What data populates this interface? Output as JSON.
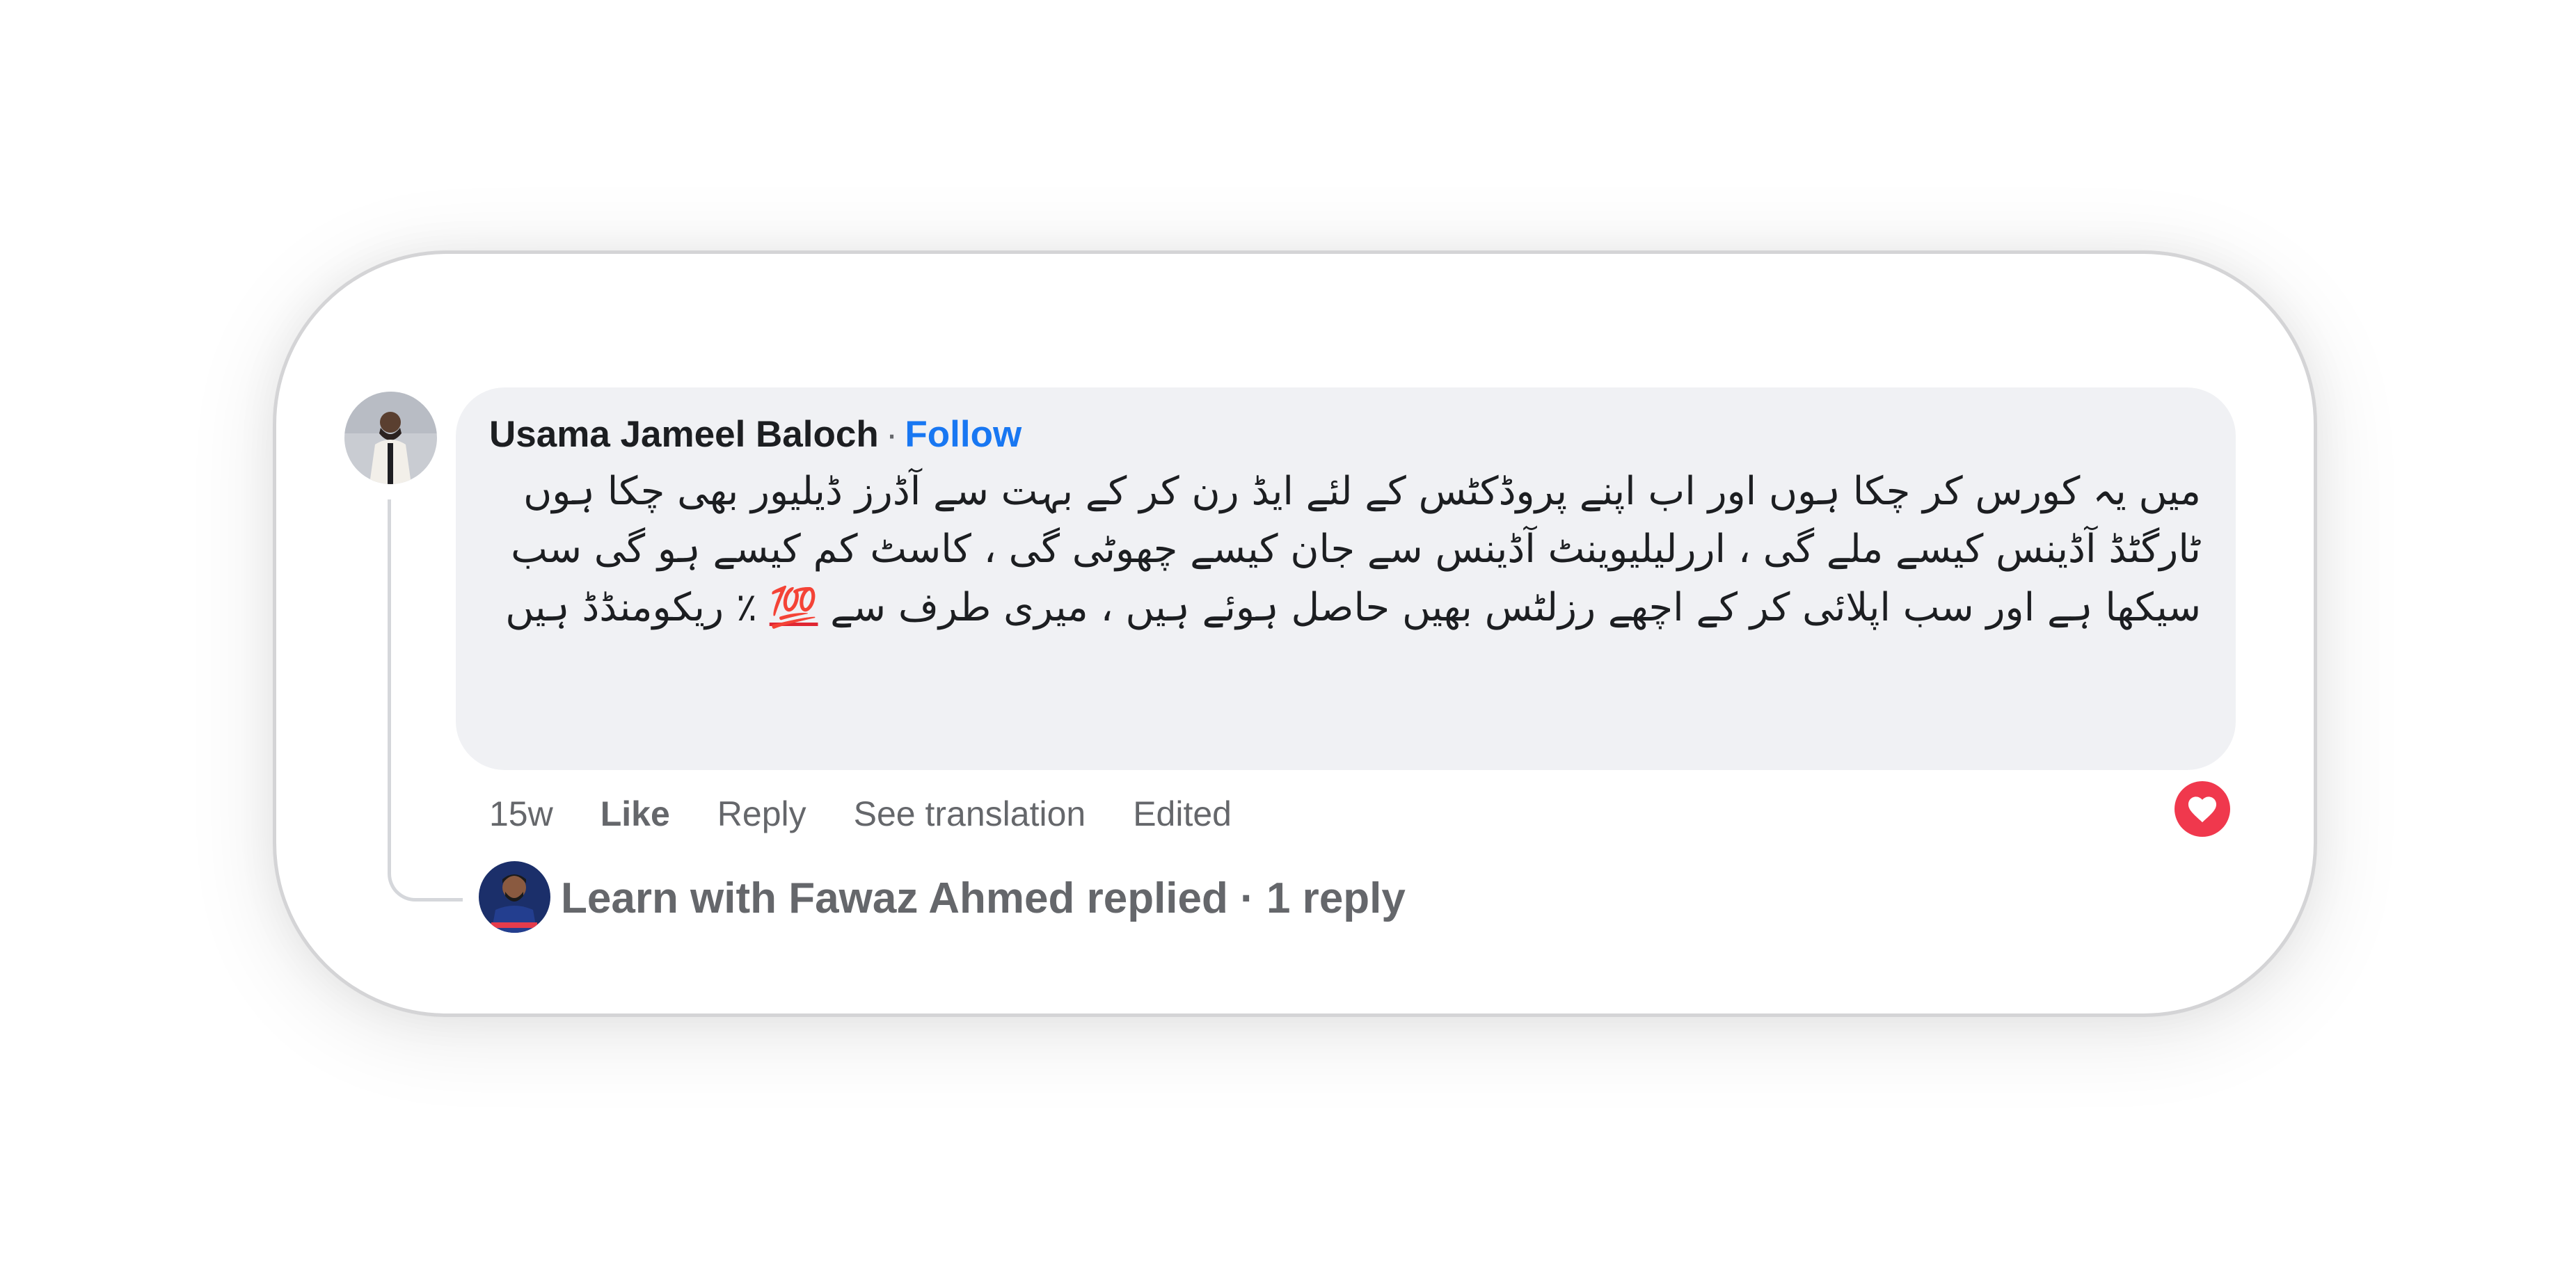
{
  "comment": {
    "author": "Usama Jameel Baloch",
    "separator": "·",
    "follow_label": "Follow",
    "text_lines": [
      "میں یہ کورس کر چکا ہوں اور اب اپنے پروڈکٹس کے لئے ایڈ رن کر کے بہت سے آڈرز ڈیلیور بھی چکا ہوں",
      "ٹارگٹڈ آڈینس کیسے ملے گی ، اررلیلیوینٹ آڈینس سے جان کیسے چھوٹی گی ، کاسٹ کم کیسے ہو گی سب سیکھا ہے اور سب اپلائی کر کے اچھے رزلٹس بھیں حاصل ہوئے ہیں ، میری طرف سے"
    ],
    "emoji_100": "💯",
    "percent_tail": "٪ ریکومنڈڈ ہیں",
    "time": "15w",
    "like_label": "Like",
    "reply_label": "Reply",
    "translate_label": "See translation",
    "edited_label": "Edited",
    "reaction_icon": "heart-icon",
    "accent_color": "#1877f2",
    "reaction_color": "#f0384d"
  },
  "reply_summary": {
    "text": "Learn with Fawaz Ahmed replied · 1 reply"
  }
}
